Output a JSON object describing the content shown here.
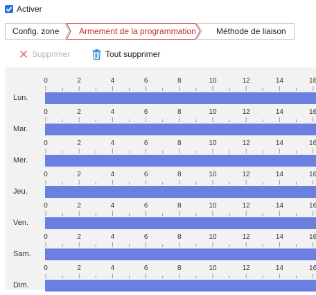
{
  "enable": {
    "label": "Activer",
    "checked": true
  },
  "tabs": [
    {
      "label": "Config. zone",
      "active": false
    },
    {
      "label": "Armement de la programmation",
      "active": true
    },
    {
      "label": "Méthode de liaison",
      "active": false
    }
  ],
  "toolbar": {
    "delete_label": "Supprimer",
    "delete_icon": "close-icon",
    "delete_all_label": "Tout supprimer",
    "delete_all_icon": "trash-icon"
  },
  "schedule": {
    "hour_ticks": [
      "0",
      "2",
      "4",
      "6",
      "8",
      "10",
      "12",
      "14",
      "16"
    ],
    "days": [
      {
        "label": "Lun."
      },
      {
        "label": "Mar."
      },
      {
        "label": "Mer."
      },
      {
        "label": "Jeu."
      },
      {
        "label": "Ven."
      },
      {
        "label": "Sam."
      },
      {
        "label": "Dim."
      }
    ],
    "bar_color": "#6b7fe0"
  },
  "colors": {
    "accent": "#2f6fe4",
    "active_tab": "#c62828",
    "disabled": "#b8b8b8",
    "delete_icon": "#e57373",
    "trash_icon": "#2f86d6"
  }
}
